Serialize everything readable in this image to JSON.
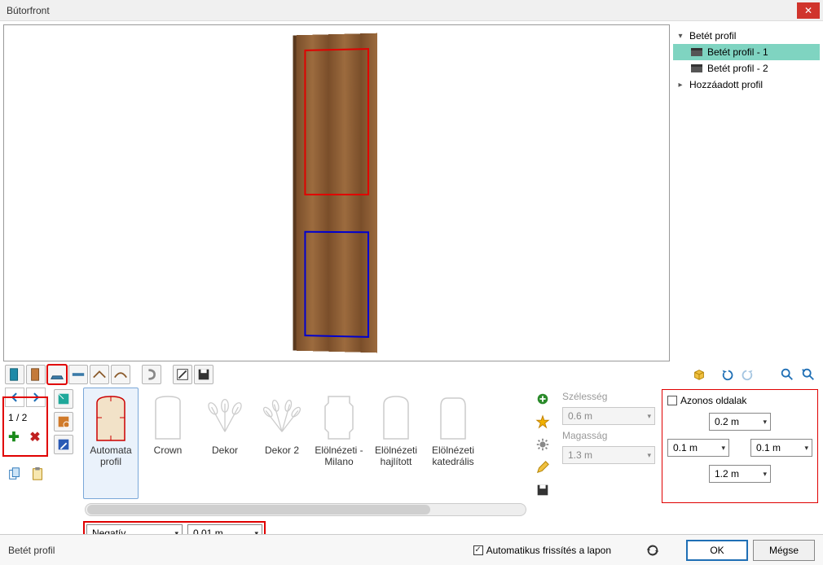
{
  "window": {
    "title": "Bútorfront"
  },
  "tree": {
    "root_label": "Betét profil",
    "items": [
      {
        "label": "Betét profil - 1",
        "selected": true
      },
      {
        "label": "Betét profil - 2",
        "selected": false
      }
    ],
    "added_label": "Hozzáadott profil"
  },
  "toolbar": {
    "icons": [
      "panel-icon",
      "panel-alt-icon",
      "profile-icon",
      "rail-icon",
      "edge-icon",
      "edge2-icon",
      "handle-icon",
      "edit-icon",
      "save-icon"
    ],
    "right_icons": [
      "cube-icon",
      "undo-icon",
      "redo-icon",
      "zoom-in-icon",
      "zoom-out-icon"
    ]
  },
  "pager": {
    "label": "1 / 2"
  },
  "side_icons": [
    "book-teal-icon",
    "book-orange-icon",
    "book-blue-icon"
  ],
  "copy_icons": [
    "copy-icon",
    "paste-icon"
  ],
  "gallery": {
    "items": [
      {
        "label": "Automata profil",
        "selected": true,
        "thumb": "arch"
      },
      {
        "label": "Crown",
        "thumb": "crown"
      },
      {
        "label": "Dekor",
        "thumb": "fan"
      },
      {
        "label": "Dekor 2",
        "thumb": "fan2"
      },
      {
        "label": "Elölnézeti - Milano",
        "thumb": "shield"
      },
      {
        "label": "Elölnézeti hajlított",
        "thumb": "curved"
      },
      {
        "label": "Elölnézeti katedrális",
        "thumb": "cathedral"
      }
    ]
  },
  "actions": [
    "add-icon",
    "star-icon",
    "gear-icon",
    "pencil-icon",
    "disk-icon"
  ],
  "dims": {
    "width_label": "Szélesség",
    "width_value": "0.6 m",
    "height_label": "Magasság",
    "height_value": "1.3 m"
  },
  "sides": {
    "same_label": "Azonos oldalak",
    "top": "0.2 m",
    "left": "0.1 m",
    "right": "0.1 m",
    "bottom": "1.2 m"
  },
  "profile_mode": {
    "value": "Negatív",
    "depth": "0.01 m"
  },
  "footer": {
    "status": "Betét profil",
    "auto_refresh_label": "Automatikus frissítés a lapon",
    "ok": "OK",
    "cancel": "Mégse"
  },
  "colors": {
    "accent_red": "#e00000",
    "accent_blue": "#0000d0",
    "sel_teal": "#7fd4c1",
    "primary": "#1f6fb5"
  }
}
